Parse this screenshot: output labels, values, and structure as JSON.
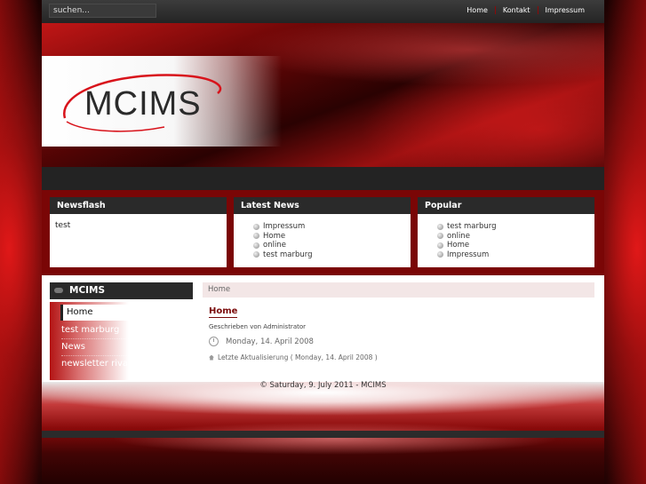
{
  "search": {
    "placeholder": "suchen..."
  },
  "topnav": {
    "items": [
      "Home",
      "Kontakt",
      "Impressum"
    ]
  },
  "logo": {
    "text": "MCIMS"
  },
  "boxes": [
    {
      "title": "Newsflash",
      "text": "test",
      "items": []
    },
    {
      "title": "Latest News",
      "items": [
        "Impressum",
        "Home",
        "online",
        "test marburg"
      ]
    },
    {
      "title": "Popular",
      "items": [
        "test marburg",
        "online",
        "Home",
        "Impressum"
      ]
    }
  ],
  "sidebar": {
    "title": "MCIMS",
    "items": [
      "Home",
      "test marburg",
      "News",
      "newsletter riva"
    ],
    "active": "Home"
  },
  "breadcrumb": "Home",
  "article": {
    "title": "Home",
    "author": "Geschrieben von Administrator",
    "date": "Monday, 14. April 2008",
    "updated": "Letzte Aktualisierung ( Monday, 14. April 2008 )"
  },
  "footer": {
    "text": "© Saturday, 9. July 2011 - MCIMS"
  },
  "colors": {
    "accent": "#7a0606",
    "header_dark": "#2a2a2a",
    "breadcrumb_bg": "#f3e6e6"
  }
}
